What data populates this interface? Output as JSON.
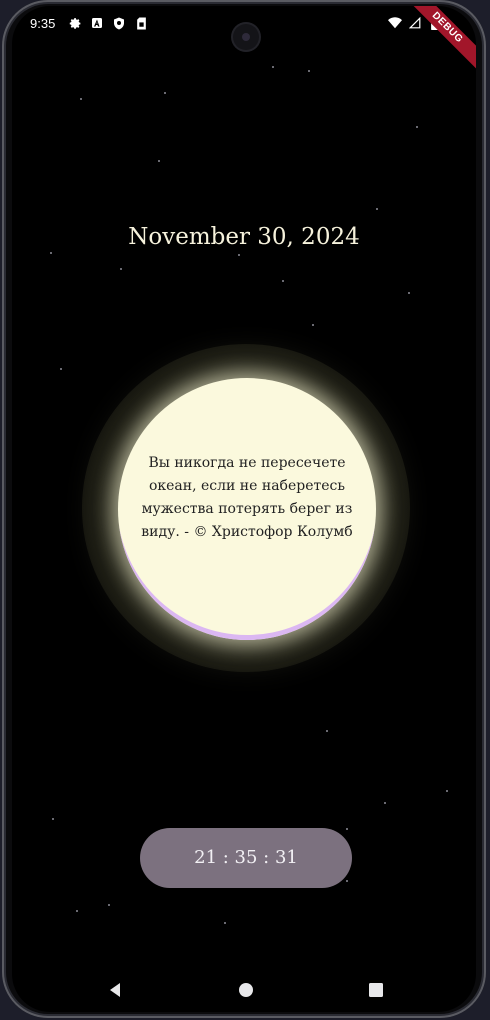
{
  "status_bar": {
    "time": "9:35",
    "left_icons": [
      "gear-icon",
      "a-letter-icon",
      "shield-icon",
      "sim-card-icon"
    ],
    "right_icons": [
      "wifi-icon",
      "signal-icon",
      "battery-icon"
    ]
  },
  "debug_banner": "DEBUG",
  "date": "November 30, 2024",
  "quote": {
    "text": "Вы никогда не пересечете океан, если не наберетесь мужества потерять берег из виду. - © Христофор Колумб"
  },
  "clock": {
    "time": "21 : 35 : 31"
  },
  "navigation": {
    "buttons": [
      "back-icon",
      "home-icon",
      "recents-icon"
    ]
  },
  "colors": {
    "background": "#000000",
    "moon": "#fbf9dd",
    "moon_rim": "#dbb7f2",
    "clock_pill": "#7c717f",
    "date_text": "#f6f2dc",
    "debug_banner": "#a2162a"
  }
}
